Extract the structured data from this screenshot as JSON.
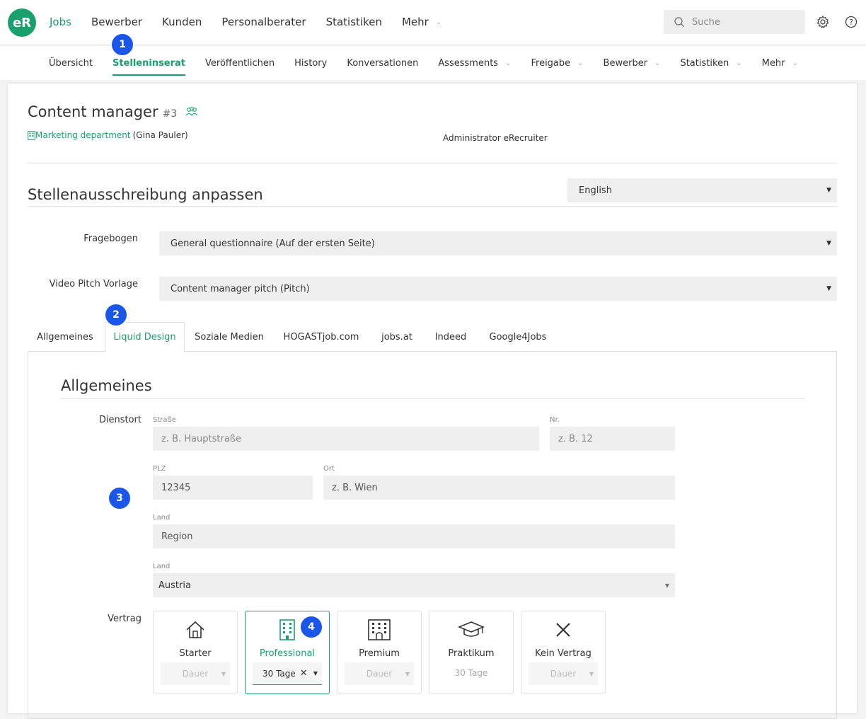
{
  "logo": "eR",
  "mainnav": {
    "items": [
      "Jobs",
      "Bewerber",
      "Kunden",
      "Personalberater",
      "Statistiken",
      "Mehr"
    ]
  },
  "search": {
    "placeholder": "Suche"
  },
  "subnav": {
    "items": [
      "Übersicht",
      "Stelleninserat",
      "Veröffentlichen",
      "History",
      "Konversationen",
      "Assessments",
      "Freigabe",
      "Bewerber",
      "Statistiken",
      "Mehr"
    ]
  },
  "badges": [
    "1",
    "2",
    "3",
    "4"
  ],
  "job": {
    "title": "Content manager",
    "number": "#3",
    "department": "Marketing department",
    "owner": "(Gina Pauler)",
    "admin": "Administrator eRecruiter"
  },
  "customize": {
    "title": "Stellenausschreibung anpassen",
    "language": "English",
    "questionnaire_label": "Fragebogen",
    "questionnaire_value": "General questionnaire (Auf der ersten Seite)",
    "video_label": "Video Pitch Vorlage",
    "video_value": "Content manager pitch (Pitch)"
  },
  "tabs": [
    "Allgemeines",
    "Liquid Design",
    "Soziale Medien",
    "HOGASTjob.com",
    "jobs.at",
    "Indeed",
    "Google4Jobs"
  ],
  "panel": {
    "title": "Allgemeines",
    "dienstort_label": "Dienstort",
    "strasse_label": "Straße",
    "strasse_placeholder": "z. B. Hauptstraße",
    "nr_label": "Nr.",
    "nr_placeholder": "z. B. 12",
    "plz_label": "PLZ",
    "plz_placeholder": "12345",
    "ort_label": "Ort",
    "ort_placeholder": "z. B. Wien",
    "land1_label": "Land",
    "land1_placeholder": "Region",
    "land2_label": "Land",
    "land2_value": "Austria",
    "vertrag_label": "Vertrag"
  },
  "contracts": [
    {
      "label": "Starter",
      "icon": "house-icon",
      "duration": "Dauer"
    },
    {
      "label": "Professional",
      "icon": "office-building-icon",
      "duration": "30 Tage"
    },
    {
      "label": "Premium",
      "icon": "building-icon",
      "duration": "Dauer"
    },
    {
      "label": "Praktikum",
      "icon": "graduation-cap-icon",
      "duration": "30 Tage"
    },
    {
      "label": "Kein Vertrag",
      "icon": "x-icon",
      "duration": "Dauer"
    }
  ],
  "colors": {
    "accent": "#1aa06d",
    "badge": "#1a56e8"
  }
}
